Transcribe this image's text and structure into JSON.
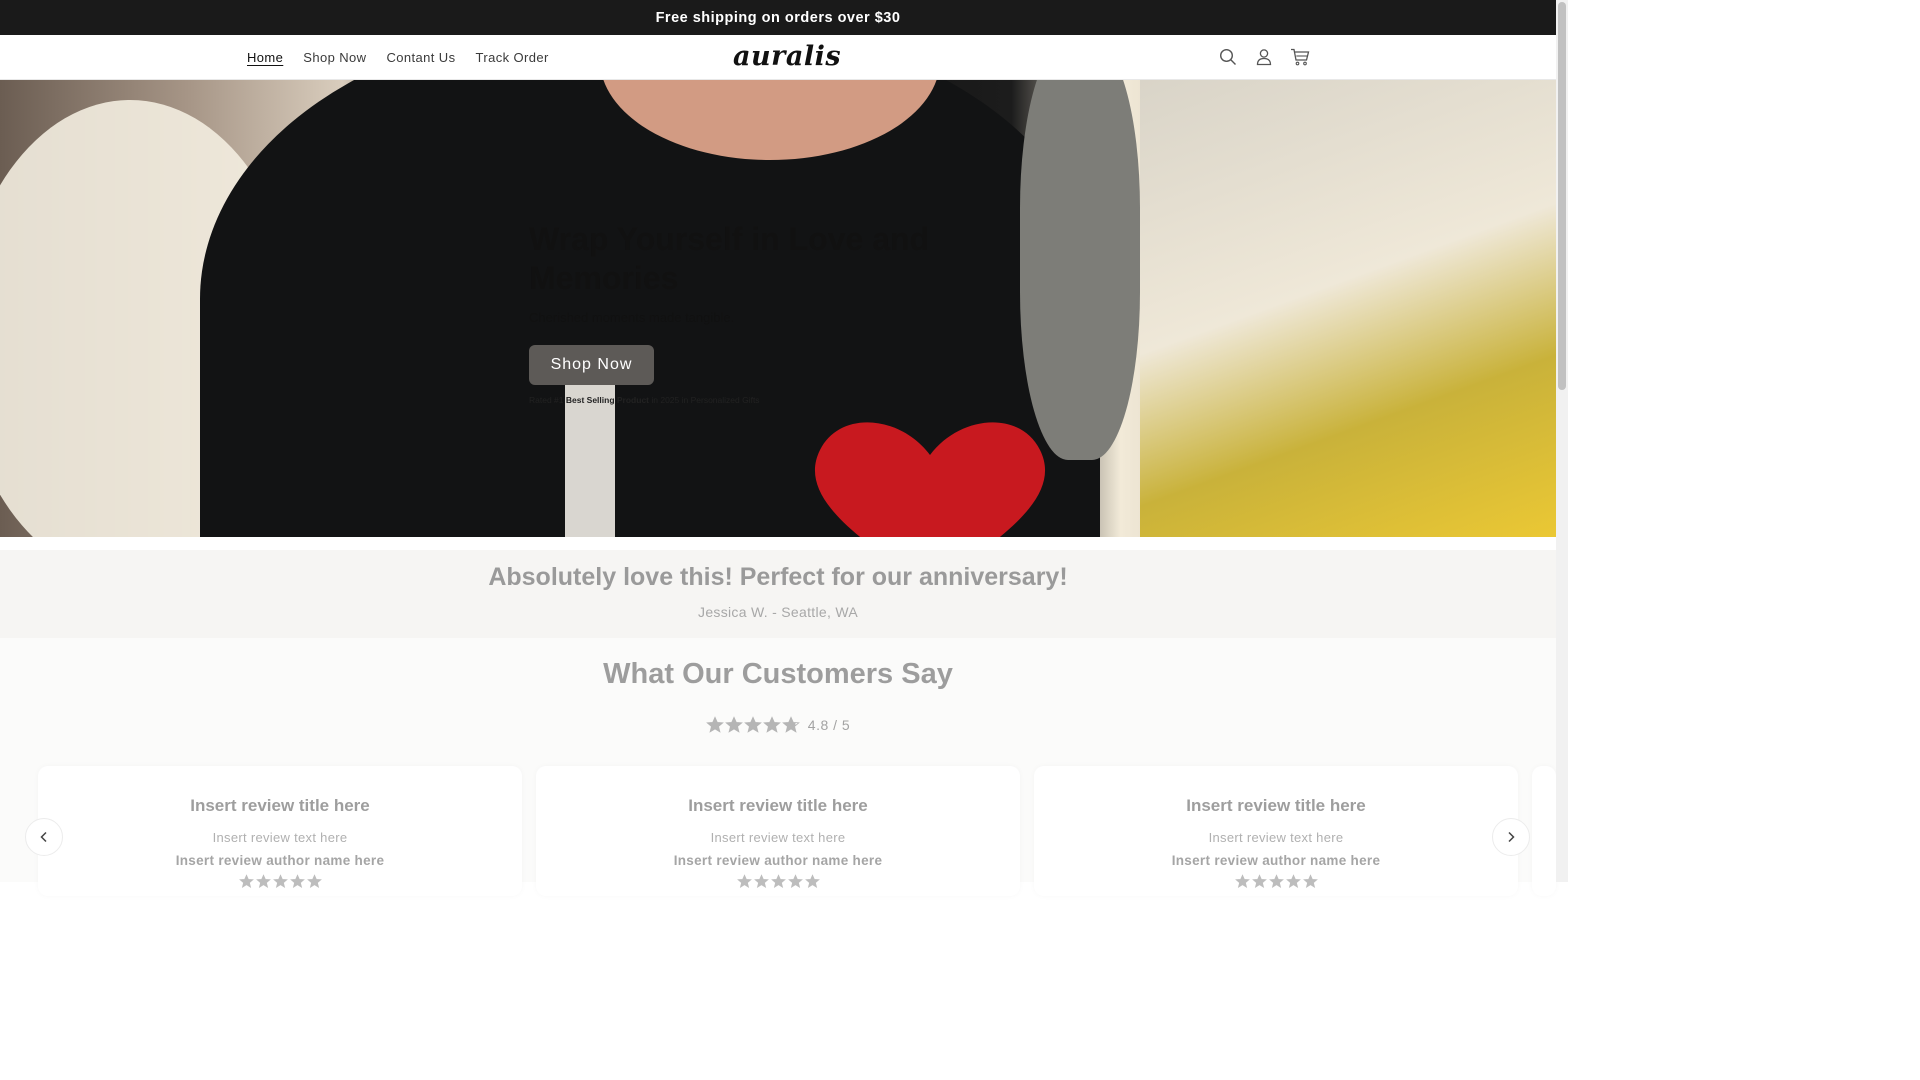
{
  "announcement": {
    "text": "Free shipping on orders over $30"
  },
  "header": {
    "logo": "auralis",
    "nav": [
      {
        "label": "Home",
        "active": true
      },
      {
        "label": "Shop Now",
        "active": false
      },
      {
        "label": "Contant Us",
        "active": false
      },
      {
        "label": "Track Order",
        "active": false
      }
    ],
    "icons": [
      "search-icon",
      "account-icon",
      "cart-icon"
    ]
  },
  "hero": {
    "title": "Wrap Yourself in Love and Memories",
    "subtitle": "Cherished moments made tangible.",
    "button_label": "Shop Now",
    "rated_prefix": "Rated #1 ",
    "rated_bold": "Best Selling Product",
    "rated_suffix": " in 2025 in Personalized Gifts"
  },
  "featured_review": {
    "quote": "Absolutely love this! Perfect for our anniversary!",
    "author": "Jessica W. - Seattle, WA"
  },
  "reviews": {
    "title": "What Our Customers Say",
    "rating_value": "4.8 / 5",
    "rating": 4.8,
    "cards": [
      {
        "title": "Insert review title here",
        "text": "Insert review text here",
        "author": "Insert review author name here",
        "stars": 5
      },
      {
        "title": "Insert review title here",
        "text": "Insert review text here",
        "author": "Insert review author name here",
        "stars": 5
      },
      {
        "title": "Insert review title here",
        "text": "Insert review text here",
        "author": "Insert review author name here",
        "stars": 5
      }
    ]
  },
  "colors": {
    "announcement_bg": "#1a1a1a",
    "button_bg": "#5d5a57",
    "muted_text": "#9d9d9d",
    "heart": "#c8191f"
  }
}
